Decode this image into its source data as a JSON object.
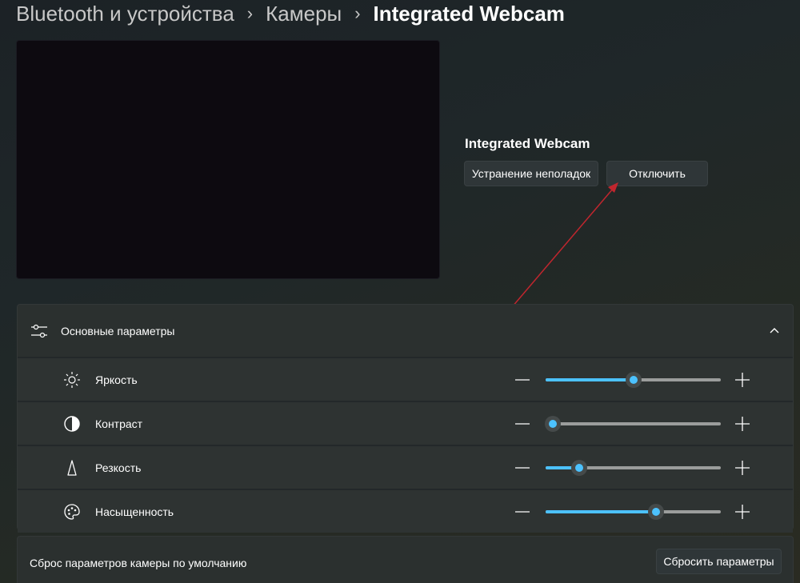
{
  "breadcrumb": {
    "items": [
      "Bluetooth и устройства",
      "Камеры"
    ],
    "current": "Integrated Webcam"
  },
  "camera": {
    "name": "Integrated Webcam",
    "troubleshoot_label": "Устранение неполадок",
    "disable_label": "Отключить"
  },
  "basic_settings": {
    "title": "Основные параметры",
    "expanded": true,
    "rows": [
      {
        "label": "Яркость",
        "icon": "brightness-icon",
        "value": 0.5
      },
      {
        "label": "Контраст",
        "icon": "contrast-icon",
        "value": 0.04
      },
      {
        "label": "Резкость",
        "icon": "sharpness-icon",
        "value": 0.19
      },
      {
        "label": "Насыщенность",
        "icon": "saturation-icon",
        "value": 0.63
      }
    ]
  },
  "reset": {
    "label": "Сброс параметров камеры по умолчанию",
    "button_label": "Сбросить параметры"
  },
  "colors": {
    "accent": "#4cc2ff",
    "annotation_arrow": "#c0262e"
  }
}
